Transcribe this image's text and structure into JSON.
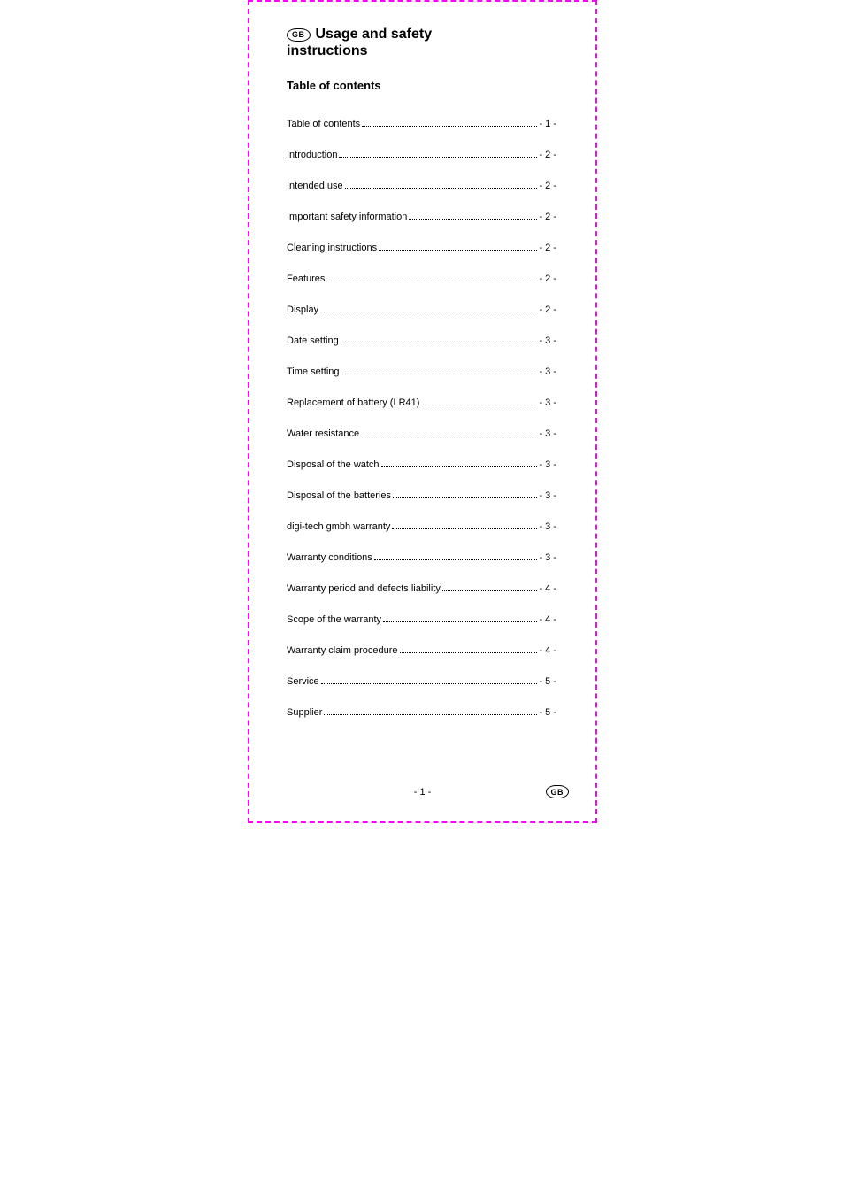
{
  "country_badge": "GB",
  "title_line1": "Usage and safety",
  "title_line2": "instructions",
  "subheading": "Table of contents",
  "toc": [
    {
      "label": "Table of contents",
      "page": "- 1 -"
    },
    {
      "label": "Introduction",
      "page": "- 2 -"
    },
    {
      "label": "Intended use",
      "page": "- 2 -"
    },
    {
      "label": "Important safety information",
      "page": "- 2 -"
    },
    {
      "label": "Cleaning instructions",
      "page": "- 2 -"
    },
    {
      "label": "Features",
      "page": "- 2 -"
    },
    {
      "label": "Display",
      "page": "- 2 -"
    },
    {
      "label": "Date setting",
      "page": "- 3 -"
    },
    {
      "label": "Time setting",
      "page": "- 3 -"
    },
    {
      "label": "Replacement of battery (LR41)",
      "page": "- 3 -"
    },
    {
      "label": "Water resistance",
      "page": "- 3 -"
    },
    {
      "label": "Disposal of the watch",
      "page": "- 3 -"
    },
    {
      "label": "Disposal of the batteries",
      "page": "- 3 -"
    },
    {
      "label": "digi-tech gmbh warranty",
      "page": "- 3 -"
    },
    {
      "label": "Warranty conditions",
      "page": "- 3 -"
    },
    {
      "label": "Warranty period and defects liability",
      "page": "- 4 -"
    },
    {
      "label": "Scope of the warranty",
      "page": "- 4 -"
    },
    {
      "label": "Warranty claim procedure",
      "page": "- 4 -"
    },
    {
      "label": "Service",
      "page": "- 5 -"
    },
    {
      "label": "Supplier",
      "page": "- 5 -"
    }
  ],
  "footer": {
    "page_number": "- 1 -",
    "badge": "GB"
  }
}
